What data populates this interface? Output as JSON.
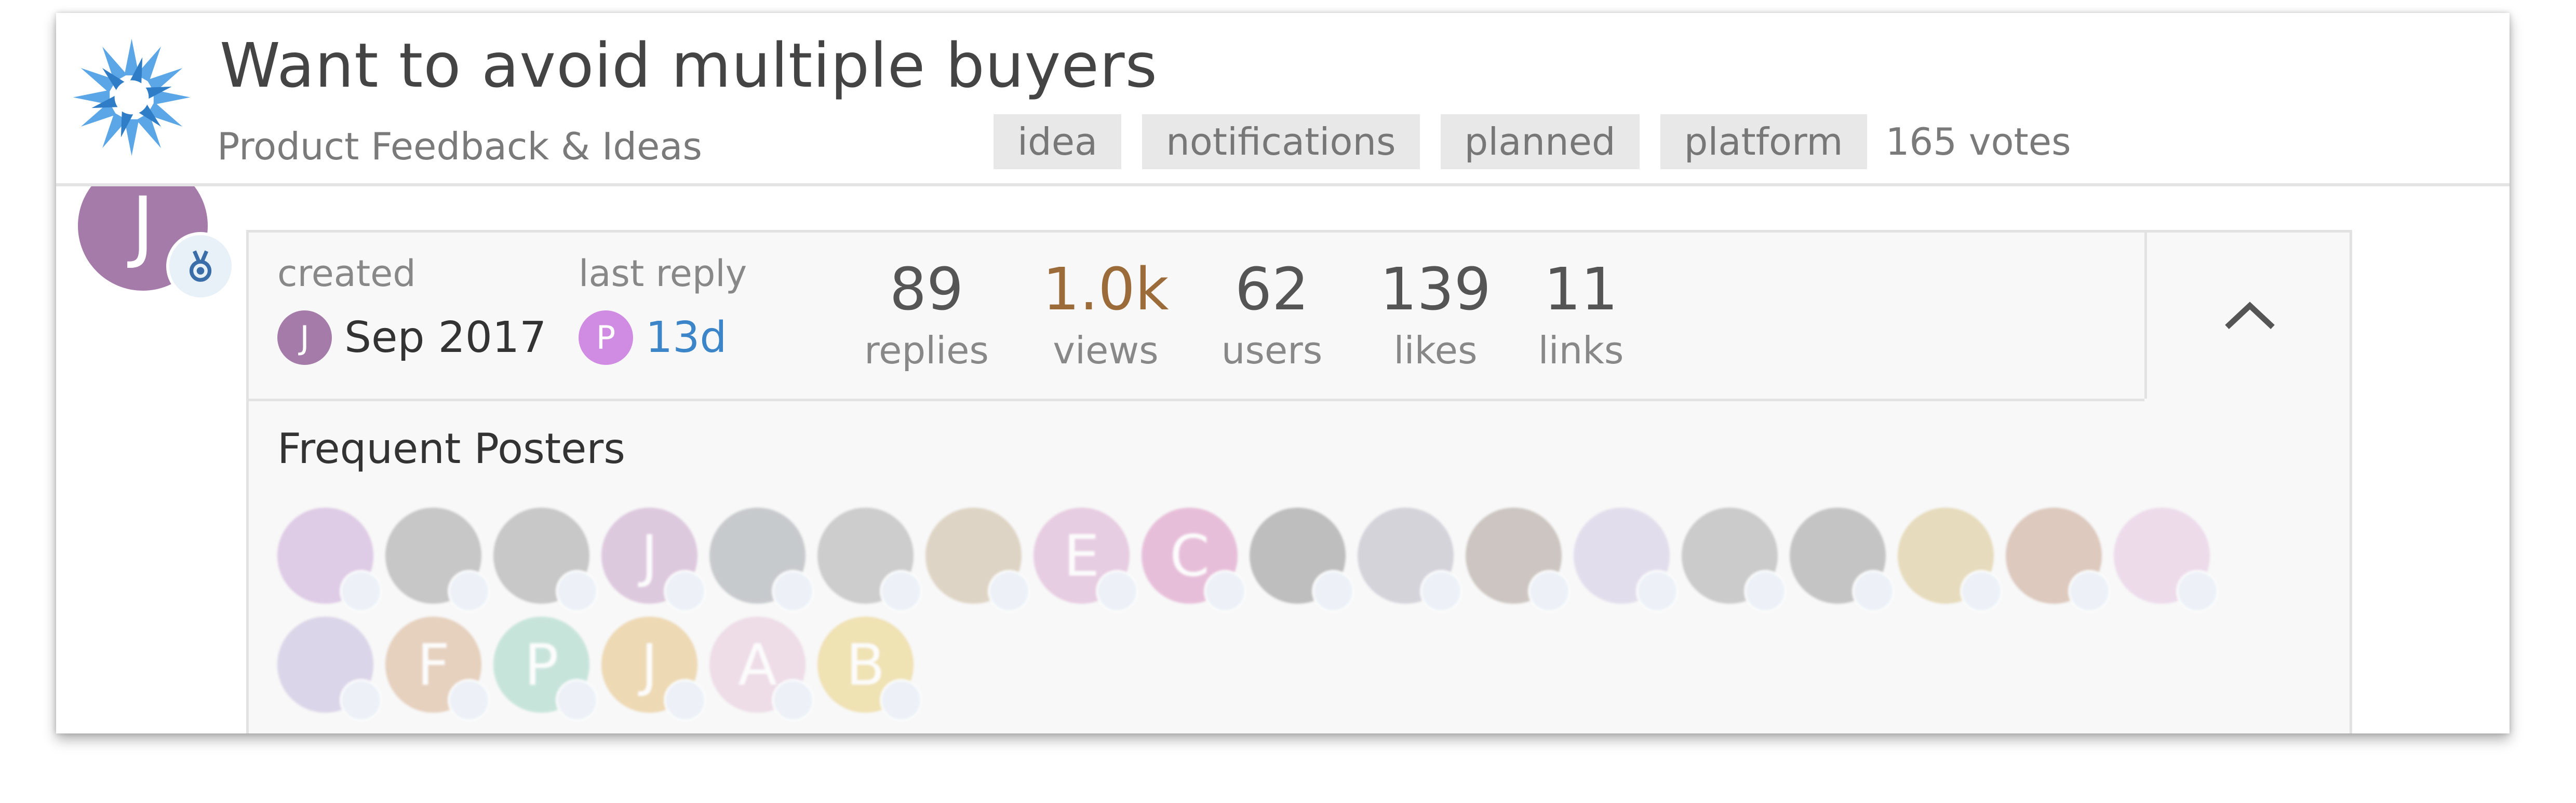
{
  "topic": {
    "title": "Want to avoid multiple buyers",
    "category": "Product Feedback & Ideas",
    "tags": [
      "idea",
      "notifications",
      "planned",
      "platform"
    ],
    "votes": "165 votes"
  },
  "author": {
    "initial": "J",
    "color": "#a57ba9"
  },
  "map": {
    "created_label": "created",
    "created_initial": "J",
    "created_value": "Sep 2017",
    "last_reply_label": "last reply",
    "last_reply_initial": "P",
    "last_reply_value": "13d",
    "stats": [
      {
        "value": "89",
        "label": "replies",
        "color": "#555555"
      },
      {
        "value": "1.0k",
        "label": "views",
        "color": "#9b6b3a"
      },
      {
        "value": "62",
        "label": "users",
        "color": "#555555"
      },
      {
        "value": "139",
        "label": "likes",
        "color": "#555555"
      },
      {
        "value": "11",
        "label": "links",
        "color": "#555555"
      }
    ],
    "frequent_posters_label": "Frequent Posters",
    "posters": [
      {
        "initial": "",
        "color": "#c9a6d6"
      },
      {
        "initial": "",
        "color": "#9e9e9e"
      },
      {
        "initial": "",
        "color": "#a0a0a0"
      },
      {
        "initial": "J",
        "color": "#c7a2c8"
      },
      {
        "initial": "",
        "color": "#9fa4a8"
      },
      {
        "initial": "",
        "color": "#a9a9a9"
      },
      {
        "initial": "",
        "color": "#c9b79b"
      },
      {
        "initial": "E",
        "color": "#d9a9cf"
      },
      {
        "initial": "C",
        "color": "#d98fbf"
      },
      {
        "initial": "",
        "color": "#8e8e8e"
      },
      {
        "initial": "",
        "color": "#b8b4c2"
      },
      {
        "initial": "",
        "color": "#a89c94"
      },
      {
        "initial": "",
        "color": "#cfc7e2"
      },
      {
        "initial": "",
        "color": "#a6a6a6"
      },
      {
        "initial": "",
        "color": "#9a9a9a"
      },
      {
        "initial": "",
        "color": "#d7c38b"
      },
      {
        "initial": "",
        "color": "#c6a28e"
      },
      {
        "initial": "",
        "color": "#e3c3df"
      },
      {
        "initial": "",
        "color": "#c3b8dc"
      },
      {
        "initial": "F",
        "color": "#d7b08f"
      },
      {
        "initial": "P",
        "color": "#9fd4c4"
      },
      {
        "initial": "J",
        "color": "#e4bf7c"
      },
      {
        "initial": "A",
        "color": "#e5c6d8"
      },
      {
        "initial": "B",
        "color": "#e8cf7b"
      }
    ]
  },
  "colors": {
    "accent": "#4a8ed6",
    "last_reply": "#3c85c8",
    "p_avatar": "#d08ce2"
  }
}
